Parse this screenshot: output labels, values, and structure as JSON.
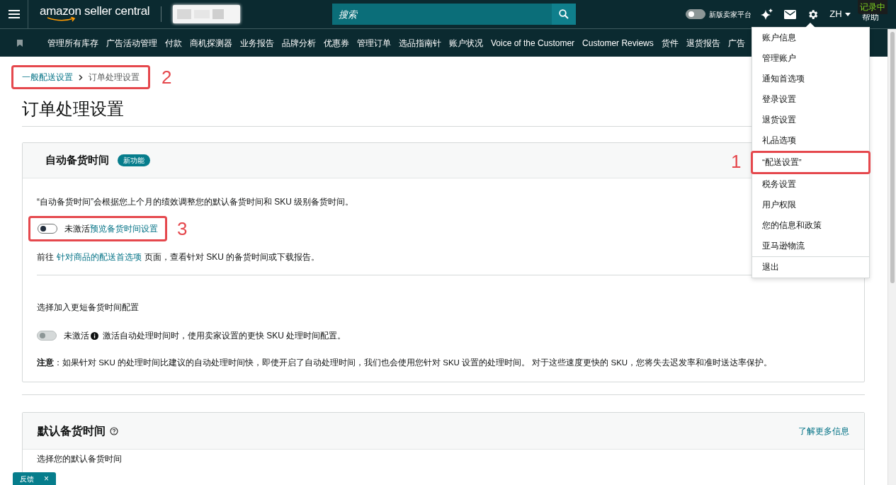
{
  "header": {
    "logo": "amazon seller central",
    "search": {
      "placeholder": "搜索"
    },
    "new_platform_toggle": {
      "on": false,
      "label": "新版卖家平台"
    },
    "language": "ZH",
    "help": "帮助",
    "recording": "记录中"
  },
  "nav": {
    "items": [
      "管理所有库存",
      "广告活动管理",
      "付款",
      "商机探测器",
      "业务报告",
      "品牌分析",
      "优惠券",
      "管理订单",
      "选品指南针",
      "账户状况",
      "Voice of the Customer",
      "Customer Reviews",
      "货件",
      "退货报告",
      "广告"
    ]
  },
  "settings_menu": {
    "items": [
      {
        "label": "账户信息"
      },
      {
        "label": "管理账户"
      },
      {
        "label": "通知首选项"
      },
      {
        "label": "登录设置"
      },
      {
        "label": "退货设置"
      },
      {
        "label": "礼品选项"
      },
      {
        "label": "“配送设置”",
        "annotation": "1"
      },
      {
        "label": "税务设置"
      },
      {
        "label": "用户权限"
      },
      {
        "label": "您的信息和政策"
      },
      {
        "label": "亚马逊物流"
      },
      {
        "label": "退出"
      }
    ]
  },
  "breadcrumb": {
    "items": [
      "一般配送设置",
      "订单处理设置"
    ],
    "annotation": "2"
  },
  "page_title": "订单处理设置",
  "auto_handling_card": {
    "title": "自动备货时间",
    "badge": "新功能",
    "description": "“自动备货时间”会根据您上个月的绩效调整您的默认备货时间和 SKU 级别备货时间。",
    "toggle": {
      "on": false,
      "disabled": false,
      "status": "未激活",
      "link": "预览备货时间设置",
      "annotation": "3"
    },
    "goto": {
      "before": "前往",
      "link": "针对商品的配送首选项",
      "after": "页面，查看针对 SKU 的备货时间或下载报告。"
    },
    "shorter_title": "选择加入更短备货时间配置",
    "shorter_toggle": {
      "on": false,
      "disabled": true,
      "status": "未激活",
      "text": "激活自动处理时间时，使用卖家设置的更快 SKU 处理时间配置。"
    },
    "note": "**注意**：如果针对 SKU 的处理时间比建议的自动处理时间快，即使开启了自动处理时间，我们也会使用您针对 SKU 设置的处理时间。 对于这些速度更快的 SKU，您将失去迟发率和准时送达率保护。"
  },
  "default_handling_card": {
    "title": "默认备货时间",
    "link": "了解更多信息",
    "body": "选择您的默认备货时间"
  },
  "feedback": {
    "label": "反馈",
    "close": "×"
  }
}
